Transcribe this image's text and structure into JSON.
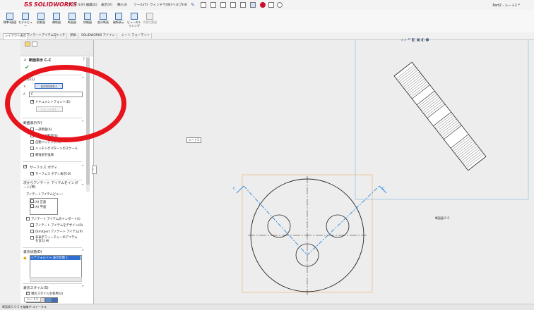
{
  "app": {
    "brand": "SOLIDWORKS",
    "document_title": "Part2 - シート1 *"
  },
  "menu": [
    "ファイル(F)",
    "編集(E)",
    "表示(V)",
    "挿入(I)",
    "ツール(T)",
    "ウィンドウ(W)",
    "ヘルプ(H)"
  ],
  "command_manager": [
    {
      "label": "標準3面図"
    },
    {
      "label": "モデルビュー"
    },
    {
      "label": "投影図"
    },
    {
      "label": "補助図"
    },
    {
      "label": "断面図"
    },
    {
      "label": "詳細図"
    },
    {
      "label": "部分断面"
    },
    {
      "label": "破断表示"
    },
    {
      "label": "ビューのトリミング"
    },
    {
      "label": "代替位置図"
    }
  ],
  "tabs": [
    "レイアウト表示",
    "アノテートアイテム",
    "スケッチ",
    "評価",
    "SOLIDWORKS アドイン",
    "シート フォーマット"
  ],
  "panel": {
    "title": "断面表示 C-C",
    "arrow_section": {
      "title": "矢印(L)",
      "flip_button": "反対方向(L)",
      "label_field": "C",
      "document_font": "ドキュメントフォント(D)",
      "font_button": "フォント(F)..."
    },
    "section_view": {
      "title": "断面表示(V)",
      "options": [
        {
          "label": "一部断面(A)",
          "checked": false
        },
        {
          "label": "スライス断面(S)",
          "checked": false
        },
        {
          "label": "自動ハッチング(H)",
          "checked": false
        },
        {
          "label": "ハッチングパターンのスケール",
          "checked": false
        },
        {
          "label": "補強部を強調",
          "checked": false
        }
      ]
    },
    "surface_bodies": {
      "title": "サーフェス ボディ",
      "checked": true,
      "option": "サーフェス ボディ表示(D)"
    },
    "import_annotations": {
      "title": "次からアノテート アイテムをインポート(M)",
      "subtitle": "アノテートアイテムビュー:",
      "items": [
        "(A) 正面",
        "(A) 平面"
      ],
      "options": [
        {
          "label": "アノテート アイテムのインポート(I)",
          "checked": false
        },
        {
          "label": "アノテート アイテムをデザイン(D)",
          "checked": false
        },
        {
          "label": "DimXpert アノテート アイテム(P)",
          "checked": false
        },
        {
          "label": "非表示フィーチャーのアイテムを含む(H)",
          "checked": false
        }
      ]
    },
    "display_state": {
      "title": "表示状態(D)",
      "item": "<デフォルト>_表示状態 1"
    },
    "display_style": {
      "title": "表示スタイル(S)",
      "option": "親のスタイルを使用(U)",
      "checked": true
    }
  },
  "graphics": {
    "section_label": "断面図 C-C",
    "view_tag": "シート1",
    "heads_up_icons": [
      "zoom-icon",
      "zoom-area-icon",
      "previous-view-icon",
      "section-icon",
      "orientation-icon",
      "display-style-icon",
      "appearance-icon"
    ],
    "colors": {
      "sheet": "#ededed",
      "view_border_blue": "#8fbfe3",
      "view_border_orange": "#f0b87a",
      "section_line": "#2d8be0"
    }
  },
  "sheet_tabs": [
    "シート1"
  ],
  "status": "断面表示 C-C を編集中 ステータス"
}
